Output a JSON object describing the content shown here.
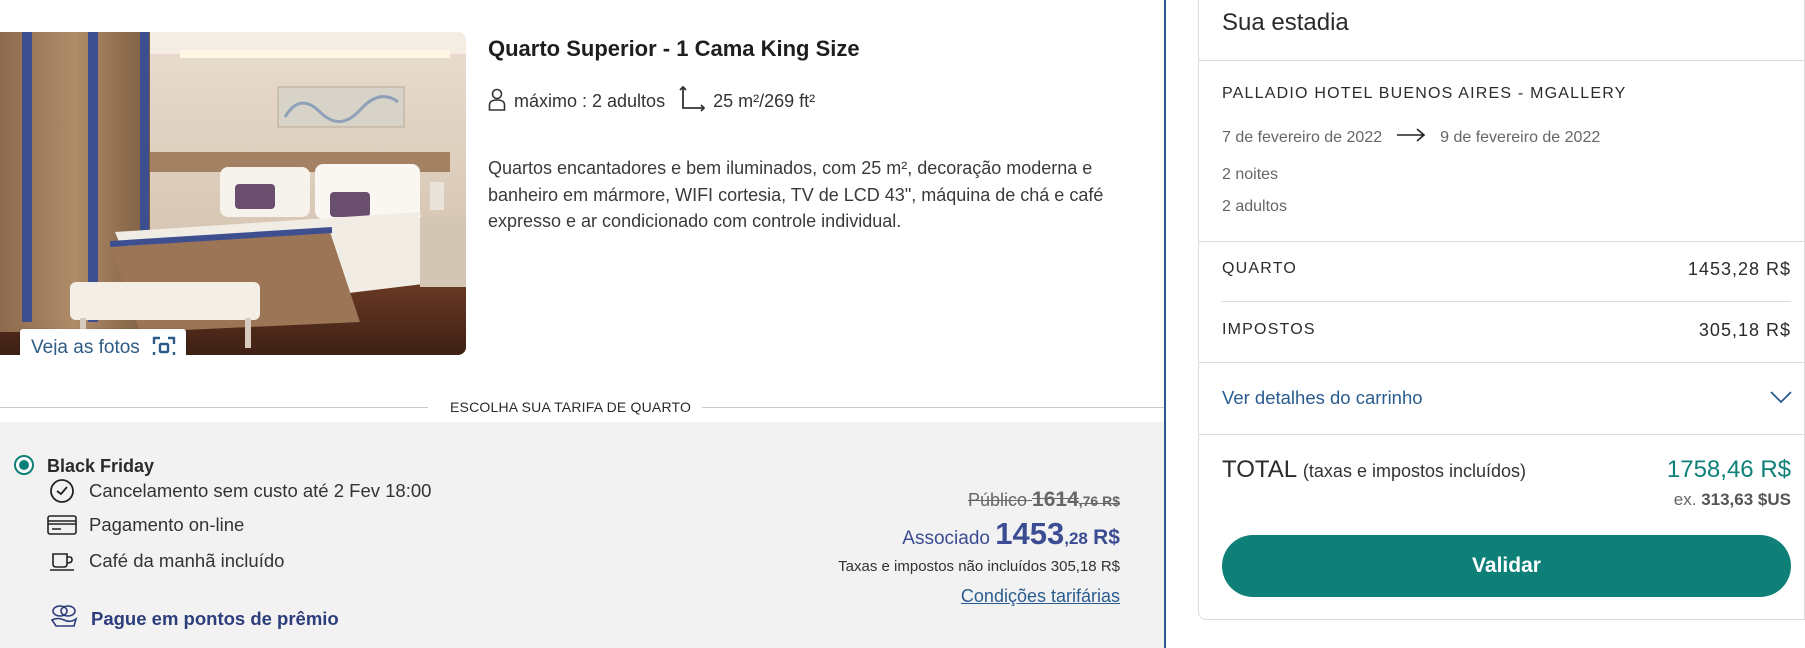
{
  "room": {
    "title": "Quarto Superior - 1 Cama King Size",
    "capacity": "máximo : 2 adultos",
    "size": "25 m²/269 ft²",
    "description": "Quartos encantadores e bem iluminados, com 25 m², decoração moderna e banheiro em mármore, WIFI cortesia, TV de LCD 43\", máquina de chá e café expresso e ar condicionado com controle individual.",
    "photos_button": "Veja as fotos"
  },
  "rate_section": {
    "divider_label": "ESCOLHA SUA TARIFA DE QUARTO",
    "rate_name": "Black Friday",
    "features": {
      "cancellation": "Cancelamento sem custo até 2 Fev 18:00",
      "payment": "Pagamento on-line",
      "breakfast": "Café da manhã incluído"
    },
    "reward_link": "Pague em pontos de prêmio",
    "public_label": "Público",
    "public_price_int": "1614",
    "public_price_dec": ",76 R$",
    "member_label": "Associado",
    "member_price_int": "1453",
    "member_price_dec": ",28",
    "member_currency": "R$",
    "tax_note": "Taxas e impostos não incluídos 305,18 R$",
    "conditions_link": "Condições tarifárias"
  },
  "stay": {
    "title": "Sua estadia",
    "hotel": "PALLADIO HOTEL BUENOS AIRES - MGALLERY",
    "checkin": "7 de fevereiro de 2022",
    "checkout": "9 de fevereiro de 2022",
    "nights": "2 noites",
    "guests": "2 adultos",
    "room_label": "QUARTO",
    "room_amount": "1453,28 R$",
    "taxes_label": "IMPOSTOS",
    "taxes_amount": "305,18 R$",
    "cart_details": "Ver detalhes do carrinho",
    "total_label": "TOTAL",
    "total_sub": "(taxas e impostos incluídos)",
    "total_amount": "1758,46 R$",
    "total_usd_prefix": "ex.",
    "total_usd_amount": "313,63",
    "total_usd_currency": "$US",
    "validate_button": "Validar"
  },
  "colors": {
    "accent_teal": "#0e8078",
    "link_blue": "#2b5c8f",
    "member_price_blue": "#3b4c92"
  }
}
